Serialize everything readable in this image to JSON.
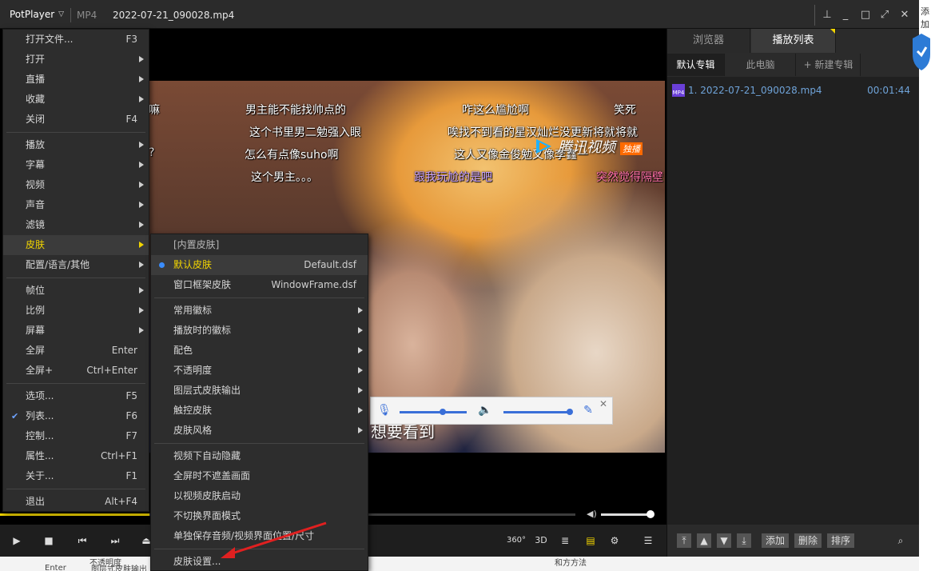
{
  "titlebar": {
    "app_name": "PotPlayer",
    "format": "MP4",
    "filename": "2022-07-21_090028.mp4",
    "buttons": [
      "pin-icon",
      "minimize-icon",
      "restore-icon",
      "fullscreen-icon",
      "close-icon"
    ]
  },
  "main_menu": {
    "items": [
      {
        "label": "打开文件...",
        "shortcut": "F3"
      },
      {
        "label": "打开",
        "submenu": true
      },
      {
        "label": "直播",
        "submenu": true
      },
      {
        "label": "收藏",
        "submenu": true
      },
      {
        "label": "关闭",
        "shortcut": "F4"
      },
      {
        "label": "播放",
        "submenu": true
      },
      {
        "label": "字幕",
        "submenu": true
      },
      {
        "label": "视频",
        "submenu": true
      },
      {
        "label": "声音",
        "submenu": true
      },
      {
        "label": "滤镜",
        "submenu": true
      },
      {
        "label": "皮肤",
        "submenu": true,
        "highlighted": true
      },
      {
        "label": "配置/语言/其他",
        "submenu": true
      },
      {
        "label": "帧位",
        "submenu": true
      },
      {
        "label": "比例",
        "submenu": true
      },
      {
        "label": "屏幕",
        "submenu": true
      },
      {
        "label": "全屏",
        "shortcut": "Enter"
      },
      {
        "label": "全屏+",
        "shortcut": "Ctrl+Enter"
      },
      {
        "label": "选项...",
        "shortcut": "F5"
      },
      {
        "label": "列表...",
        "shortcut": "F6",
        "checked": true
      },
      {
        "label": "控制...",
        "shortcut": "F7"
      },
      {
        "label": "属性...",
        "shortcut": "Ctrl+F1"
      },
      {
        "label": "关于...",
        "shortcut": "F1"
      },
      {
        "label": "退出",
        "shortcut": "Alt+F4"
      }
    ]
  },
  "skin_menu": {
    "items": [
      {
        "label": "[内置皮肤]"
      },
      {
        "label": "默认皮肤",
        "value": "Default.dsf",
        "selected": true
      },
      {
        "label": "窗口框架皮肤",
        "value": "WindowFrame.dsf"
      },
      {
        "label": "常用徽标",
        "submenu": true
      },
      {
        "label": "播放时的徽标",
        "submenu": true
      },
      {
        "label": "配色",
        "submenu": true
      },
      {
        "label": "不透明度",
        "submenu": true
      },
      {
        "label": "图层式皮肤输出",
        "submenu": true
      },
      {
        "label": "触控皮肤",
        "submenu": true
      },
      {
        "label": "皮肤风格",
        "submenu": true
      },
      {
        "label": "视频下自动隐藏"
      },
      {
        "label": "全屏时不遮盖画面"
      },
      {
        "label": "以视频皮肤启动"
      },
      {
        "label": "不切换界面模式"
      },
      {
        "label": "单独保存音频/视频界面位置/尺寸"
      },
      {
        "label": "皮肤设置..."
      }
    ]
  },
  "video": {
    "danmaku": [
      "嘛",
      "男主能不能找帅点的",
      "咋这么尴尬啊",
      "笑死",
      "这个书里男二勉强入眼",
      "唉找不到看的星汉灿烂没更新将就将就",
      "?",
      "怎么有点像suho啊",
      "这人又像金俊勉又像李鑫一",
      "这个男主。。。",
      "跟我玩尬的是吧",
      "突然觉得隔壁"
    ],
    "logo_text": "腾讯视频",
    "logo_badge": "独播",
    "subtitle": "想要看到"
  },
  "controls": {
    "seek_progress": 0.26,
    "volume_level": 0.92,
    "buttons": [
      "play-icon",
      "stop-icon",
      "prev-icon",
      "next-icon",
      "eject-icon"
    ],
    "right_labels": {
      "vr": "360°",
      "three_d": "3D"
    }
  },
  "panel": {
    "tabs": [
      "浏览器",
      "播放列表"
    ],
    "active_tab": "播放列表",
    "subtabs": [
      "默认专辑",
      "此电脑",
      "+ 新建专辑"
    ],
    "playlist": [
      {
        "name": "1. 2022-07-21_090028.mp4",
        "duration": "00:01:44",
        "icon_label": "MP4"
      }
    ],
    "bottom_buttons": [
      "添加",
      "删除",
      "排序"
    ]
  },
  "edge": {
    "text": "添加"
  },
  "desktop_strip": {
    "texts": [
      "不透明度",
      "Enter",
      "图层式皮肤输出",
      "和方方法"
    ]
  }
}
